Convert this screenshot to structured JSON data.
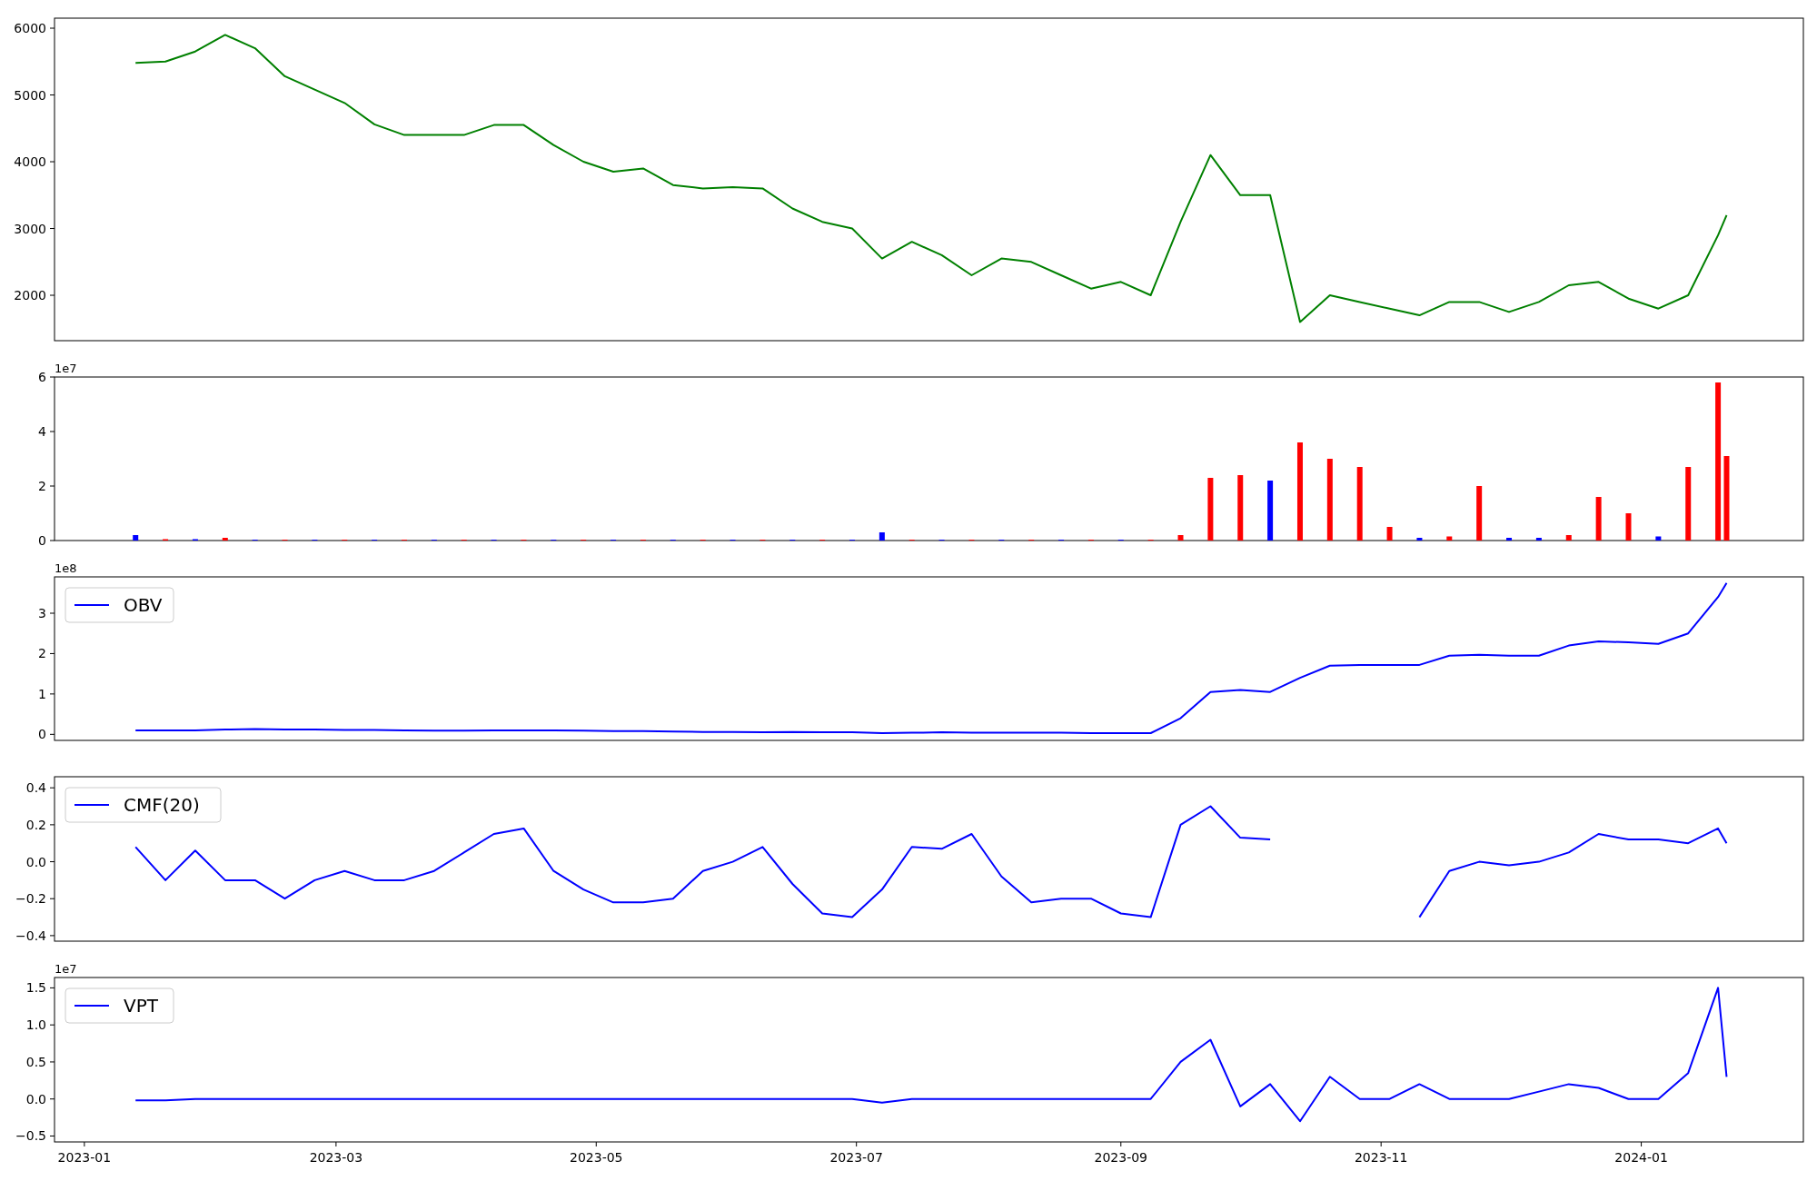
{
  "panels": [
    {
      "chart_data": {
        "type": "line",
        "xlim": [
          "2022-12-25",
          "2024-02-08"
        ],
        "ylim": [
          1320,
          6150
        ],
        "yticks": [
          {
            "value": 2000,
            "label": "2000"
          },
          {
            "value": 3000,
            "label": "3000"
          },
          {
            "value": 4000,
            "label": "4000"
          },
          {
            "value": 5000,
            "label": "5000"
          },
          {
            "value": 6000,
            "label": "6000"
          }
        ],
        "x": [
          "2023-01-13",
          "2023-01-20",
          "2023-01-27",
          "2023-02-03",
          "2023-02-10",
          "2023-02-17",
          "2023-02-24",
          "2023-03-03",
          "2023-03-10",
          "2023-03-17",
          "2023-03-24",
          "2023-03-31",
          "2023-04-07",
          "2023-04-14",
          "2023-04-21",
          "2023-04-28",
          "2023-05-05",
          "2023-05-12",
          "2023-05-19",
          "2023-05-26",
          "2023-06-02",
          "2023-06-09",
          "2023-06-16",
          "2023-06-23",
          "2023-06-30",
          "2023-07-07",
          "2023-07-14",
          "2023-07-21",
          "2023-07-28",
          "2023-08-04",
          "2023-08-11",
          "2023-08-18",
          "2023-08-25",
          "2023-09-01",
          "2023-09-08",
          "2023-09-15",
          "2023-09-22",
          "2023-09-29",
          "2023-10-06",
          "2023-10-13",
          "2023-10-20",
          "2023-10-27",
          "2023-11-03",
          "2023-11-10",
          "2023-11-17",
          "2023-11-24",
          "2023-12-01",
          "2023-12-08",
          "2023-12-15",
          "2023-12-22",
          "2023-12-29",
          "2024-01-05",
          "2024-01-12",
          "2024-01-19",
          "2024-01-21"
        ],
        "series": [
          {
            "color": "#008000",
            "values": [
              5480,
              5500,
              5650,
              5900,
              5700,
              5280,
              5080,
              4880,
              4560,
              4400,
              4400,
              4400,
              4550,
              4550,
              4250,
              4000,
              3850,
              3900,
              3650,
              3600,
              3620,
              3600,
              3300,
              3100,
              3000,
              2550,
              2800,
              2600,
              2300,
              2550,
              2500,
              2300,
              2100,
              2200,
              2000,
              3100,
              4100,
              3500,
              3500,
              1600,
              2000,
              1900,
              1800,
              1700,
              1900,
              1900,
              1750,
              1900,
              2150,
              2200,
              1950,
              1800,
              2000,
              2900,
              3200
            ]
          }
        ]
      }
    },
    {
      "scale_label": "1e7",
      "chart_data": {
        "type": "bar",
        "xlim": [
          "2022-12-25",
          "2024-02-08"
        ],
        "ylim": [
          0,
          6
        ],
        "yticks": [
          {
            "value": 0,
            "label": "0"
          },
          {
            "value": 2,
            "label": "2"
          },
          {
            "value": 4,
            "label": "4"
          },
          {
            "value": 6,
            "label": "6"
          }
        ],
        "x": [
          "2023-01-13",
          "2023-01-20",
          "2023-01-27",
          "2023-02-03",
          "2023-02-10",
          "2023-02-17",
          "2023-02-24",
          "2023-03-03",
          "2023-03-10",
          "2023-03-17",
          "2023-03-24",
          "2023-03-31",
          "2023-04-07",
          "2023-04-14",
          "2023-04-21",
          "2023-04-28",
          "2023-05-05",
          "2023-05-12",
          "2023-05-19",
          "2023-05-26",
          "2023-06-02",
          "2023-06-09",
          "2023-06-16",
          "2023-06-23",
          "2023-06-30",
          "2023-07-07",
          "2023-07-14",
          "2023-07-21",
          "2023-07-28",
          "2023-08-04",
          "2023-08-11",
          "2023-08-18",
          "2023-08-25",
          "2023-09-01",
          "2023-09-08",
          "2023-09-15",
          "2023-09-22",
          "2023-09-29",
          "2023-10-06",
          "2023-10-13",
          "2023-10-20",
          "2023-10-27",
          "2023-11-03",
          "2023-11-10",
          "2023-11-17",
          "2023-11-24",
          "2023-12-01",
          "2023-12-08",
          "2023-12-15",
          "2023-12-22",
          "2023-12-29",
          "2024-01-05",
          "2024-01-12",
          "2024-01-19",
          "2024-01-21"
        ],
        "series": [
          {
            "color": "#ff0000",
            "values": [
              null,
              0.05,
              null,
              0.1,
              null,
              0.03,
              null,
              0.03,
              null,
              0.03,
              null,
              0.03,
              null,
              0.03,
              null,
              0.03,
              null,
              0.03,
              null,
              0.03,
              null,
              0.03,
              null,
              0.03,
              null,
              null,
              0.03,
              null,
              0.03,
              null,
              0.03,
              null,
              0.03,
              null,
              0.03,
              0.2,
              2.3,
              2.4,
              null,
              3.6,
              3.0,
              2.7,
              0.5,
              null,
              0.15,
              2.0,
              null,
              null,
              0.2,
              1.6,
              1.0,
              null,
              2.7,
              5.8,
              3.1
            ]
          },
          {
            "color": "#0000ff",
            "values": [
              0.2,
              null,
              0.05,
              null,
              0.03,
              null,
              0.03,
              null,
              0.03,
              null,
              0.03,
              null,
              0.03,
              null,
              0.03,
              null,
              0.03,
              null,
              0.03,
              null,
              0.03,
              null,
              0.03,
              null,
              0.03,
              0.3,
              null,
              0.03,
              null,
              0.03,
              null,
              0.03,
              null,
              0.03,
              null,
              null,
              null,
              null,
              2.2,
              null,
              null,
              null,
              null,
              0.1,
              null,
              null,
              0.1,
              0.1,
              null,
              null,
              null,
              0.15,
              null,
              null,
              null
            ]
          }
        ]
      }
    },
    {
      "scale_label": "1e8",
      "chart_data": {
        "type": "line",
        "xlim": [
          "2022-12-25",
          "2024-02-08"
        ],
        "ylim": [
          -0.15,
          3.9
        ],
        "yticks": [
          {
            "value": 0,
            "label": "0"
          },
          {
            "value": 1,
            "label": "1"
          },
          {
            "value": 2,
            "label": "2"
          },
          {
            "value": 3,
            "label": "3"
          }
        ],
        "x": [
          "2023-01-13",
          "2023-01-20",
          "2023-01-27",
          "2023-02-03",
          "2023-02-10",
          "2023-02-17",
          "2023-02-24",
          "2023-03-03",
          "2023-03-10",
          "2023-03-17",
          "2023-03-24",
          "2023-03-31",
          "2023-04-07",
          "2023-04-14",
          "2023-04-21",
          "2023-04-28",
          "2023-05-05",
          "2023-05-12",
          "2023-05-19",
          "2023-05-26",
          "2023-06-02",
          "2023-06-09",
          "2023-06-16",
          "2023-06-23",
          "2023-06-30",
          "2023-07-07",
          "2023-07-14",
          "2023-07-21",
          "2023-07-28",
          "2023-08-04",
          "2023-08-11",
          "2023-08-18",
          "2023-08-25",
          "2023-09-01",
          "2023-09-08",
          "2023-09-15",
          "2023-09-22",
          "2023-09-29",
          "2023-10-06",
          "2023-10-13",
          "2023-10-20",
          "2023-10-27",
          "2023-11-03",
          "2023-11-10",
          "2023-11-17",
          "2023-11-24",
          "2023-12-01",
          "2023-12-08",
          "2023-12-15",
          "2023-12-22",
          "2023-12-29",
          "2024-01-05",
          "2024-01-12",
          "2024-01-19",
          "2024-01-21"
        ],
        "series": [
          {
            "name": "OBV",
            "color": "#0000ff",
            "values": [
              0.1,
              0.1,
              0.1,
              0.12,
              0.13,
              0.12,
              0.12,
              0.11,
              0.11,
              0.1,
              0.09,
              0.09,
              0.1,
              0.1,
              0.1,
              0.09,
              0.08,
              0.08,
              0.07,
              0.06,
              0.06,
              0.05,
              0.06,
              0.05,
              0.05,
              0.03,
              0.04,
              0.05,
              0.04,
              0.04,
              0.04,
              0.04,
              0.03,
              0.03,
              0.03,
              0.4,
              1.05,
              1.1,
              1.05,
              1.4,
              1.7,
              1.72,
              1.72,
              1.72,
              1.95,
              1.97,
              1.95,
              1.95,
              2.2,
              2.3,
              2.28,
              2.24,
              2.5,
              3.4,
              3.75
            ]
          }
        ]
      }
    },
    {
      "chart_data": {
        "type": "line",
        "xlim": [
          "2022-12-25",
          "2024-02-08"
        ],
        "ylim": [
          -0.43,
          0.46
        ],
        "yticks": [
          {
            "value": -0.4,
            "label": "−0.4"
          },
          {
            "value": -0.2,
            "label": "−0.2"
          },
          {
            "value": 0,
            "label": "0.0"
          },
          {
            "value": 0.2,
            "label": "0.2"
          },
          {
            "value": 0.4,
            "label": "0.4"
          }
        ],
        "x": [
          "2023-01-13",
          "2023-01-20",
          "2023-01-27",
          "2023-02-03",
          "2023-02-10",
          "2023-02-17",
          "2023-02-24",
          "2023-03-03",
          "2023-03-10",
          "2023-03-17",
          "2023-03-24",
          "2023-03-31",
          "2023-04-07",
          "2023-04-14",
          "2023-04-21",
          "2023-04-28",
          "2023-05-05",
          "2023-05-12",
          "2023-05-19",
          "2023-05-26",
          "2023-06-02",
          "2023-06-09",
          "2023-06-16",
          "2023-06-23",
          "2023-06-30",
          "2023-07-07",
          "2023-07-14",
          "2023-07-21",
          "2023-07-28",
          "2023-08-04",
          "2023-08-11",
          "2023-08-18",
          "2023-08-25",
          "2023-09-01",
          "2023-09-08",
          "2023-09-15",
          "2023-09-22",
          "2023-09-29",
          "2023-10-06",
          "2023-10-13",
          "2023-10-20",
          "2023-10-27",
          "2023-11-03",
          "2023-11-10",
          "2023-11-17",
          "2023-11-24",
          "2023-12-01",
          "2023-12-08",
          "2023-12-15",
          "2023-12-22",
          "2023-12-29",
          "2024-01-05",
          "2024-01-12",
          "2024-01-19",
          "2024-01-21"
        ],
        "series": [
          {
            "name": "CMF(20)",
            "color": "#0000ff",
            "values": [
              0.08,
              -0.1,
              0.06,
              -0.1,
              -0.1,
              -0.2,
              -0.1,
              -0.05,
              -0.1,
              -0.1,
              -0.05,
              0.05,
              0.15,
              0.18,
              -0.05,
              -0.15,
              -0.22,
              -0.22,
              -0.2,
              -0.05,
              0.0,
              0.08,
              -0.12,
              -0.28,
              -0.3,
              -0.15,
              0.08,
              0.07,
              0.15,
              -0.08,
              -0.22,
              -0.2,
              -0.2,
              -0.28,
              -0.3,
              0.2,
              0.3,
              0.13,
              0.12,
              null,
              null,
              null,
              null,
              -0.3,
              -0.05,
              0.0,
              -0.02,
              0.0,
              0.05,
              0.15,
              0.12,
              0.12,
              0.1,
              0.18,
              0.1
            ]
          }
        ]
      }
    },
    {
      "scale_label": "1e7",
      "chart_data": {
        "type": "line",
        "xlim": [
          "2022-12-25",
          "2024-02-08"
        ],
        "ylim": [
          -0.58,
          1.64
        ],
        "yticks": [
          {
            "value": -0.5,
            "label": "−0.5"
          },
          {
            "value": 0,
            "label": "0.0"
          },
          {
            "value": 0.5,
            "label": "0.5"
          },
          {
            "value": 1,
            "label": "1.0"
          },
          {
            "value": 1.5,
            "label": "1.5"
          }
        ],
        "xticks": [
          {
            "value": "2023-01-01",
            "label": "2023-01"
          },
          {
            "value": "2023-03-01",
            "label": "2023-03"
          },
          {
            "value": "2023-05-01",
            "label": "2023-05"
          },
          {
            "value": "2023-07-01",
            "label": "2023-07"
          },
          {
            "value": "2023-09-01",
            "label": "2023-09"
          },
          {
            "value": "2023-11-01",
            "label": "2023-11"
          },
          {
            "value": "2024-01-01",
            "label": "2024-01"
          }
        ],
        "x": [
          "2023-01-13",
          "2023-01-20",
          "2023-01-27",
          "2023-02-03",
          "2023-02-10",
          "2023-02-17",
          "2023-02-24",
          "2023-03-03",
          "2023-03-10",
          "2023-03-17",
          "2023-03-24",
          "2023-03-31",
          "2023-04-07",
          "2023-04-14",
          "2023-04-21",
          "2023-04-28",
          "2023-05-05",
          "2023-05-12",
          "2023-05-19",
          "2023-05-26",
          "2023-06-02",
          "2023-06-09",
          "2023-06-16",
          "2023-06-23",
          "2023-06-30",
          "2023-07-07",
          "2023-07-14",
          "2023-07-21",
          "2023-07-28",
          "2023-08-04",
          "2023-08-11",
          "2023-08-18",
          "2023-08-25",
          "2023-09-01",
          "2023-09-08",
          "2023-09-15",
          "2023-09-22",
          "2023-09-29",
          "2023-10-06",
          "2023-10-13",
          "2023-10-20",
          "2023-10-27",
          "2023-11-03",
          "2023-11-10",
          "2023-11-17",
          "2023-11-24",
          "2023-12-01",
          "2023-12-08",
          "2023-12-15",
          "2023-12-22",
          "2023-12-29",
          "2024-01-05",
          "2024-01-12",
          "2024-01-19",
          "2024-01-21"
        ],
        "series": [
          {
            "name": "VPT",
            "color": "#0000ff",
            "values": [
              -0.02,
              -0.02,
              0.0,
              0.0,
              0.0,
              0.0,
              0.0,
              0.0,
              0.0,
              0.0,
              0.0,
              0.0,
              0.0,
              0.0,
              0.0,
              0.0,
              0.0,
              0.0,
              0.0,
              0.0,
              0.0,
              0.0,
              0.0,
              0.0,
              0.0,
              -0.05,
              0.0,
              0.0,
              0.0,
              0.0,
              0.0,
              0.0,
              0.0,
              0.0,
              0.0,
              0.5,
              0.8,
              -0.1,
              0.2,
              -0.3,
              0.3,
              0.0,
              0.0,
              0.2,
              0.0,
              0.0,
              0.0,
              0.1,
              0.2,
              0.15,
              0.0,
              0.0,
              0.35,
              1.5,
              0.3
            ]
          }
        ]
      }
    }
  ]
}
